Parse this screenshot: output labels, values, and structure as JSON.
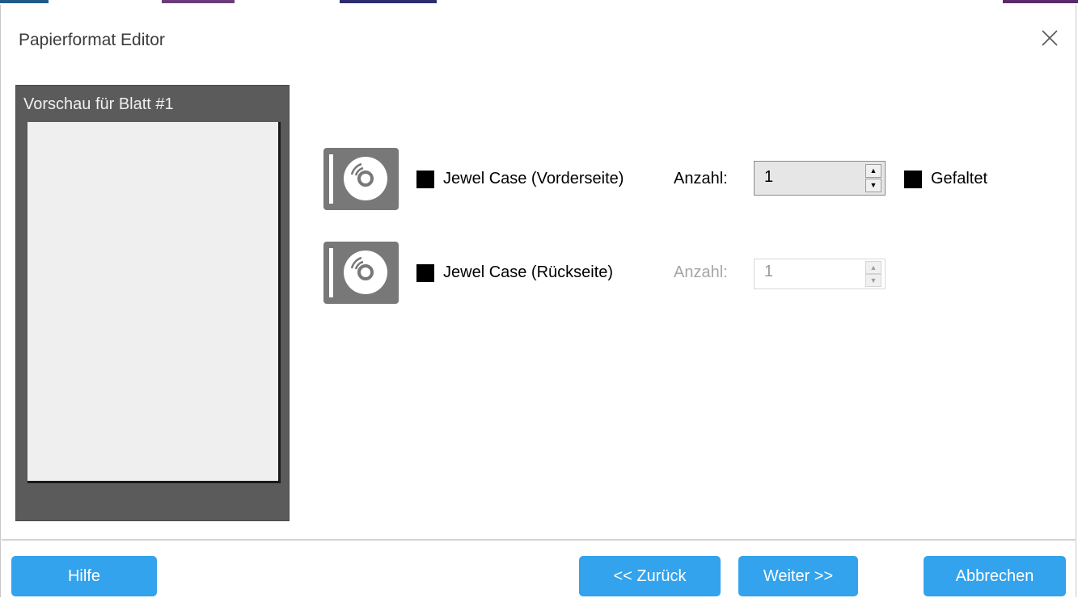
{
  "window": {
    "title": "Papierformat Editor",
    "close_icon": "close-icon"
  },
  "preview": {
    "label": "Vorschau für Blatt #1"
  },
  "items": [
    {
      "icon": "jewel-case-icon",
      "label": "Jewel Case (Vorderseite)",
      "checked": true,
      "anzahl_label": "Anzahl:",
      "anzahl_value": "1",
      "enabled": true,
      "gefaltet_label": "Gefaltet",
      "gefaltet_checked": true
    },
    {
      "icon": "jewel-case-icon",
      "label": "Jewel Case (Rückseite)",
      "checked": true,
      "anzahl_label": "Anzahl:",
      "anzahl_value": "1",
      "enabled": false
    }
  ],
  "footer": {
    "help_label": "Hilfe",
    "back_label": "<< Zurück",
    "next_label": "Weiter >>",
    "cancel_label": "Abbrechen"
  },
  "colors": {
    "button_blue": "#32a3ec",
    "preview_frame": "#5b5b5b",
    "preview_sheet": "#efefef",
    "icon_gray": "#787878"
  }
}
